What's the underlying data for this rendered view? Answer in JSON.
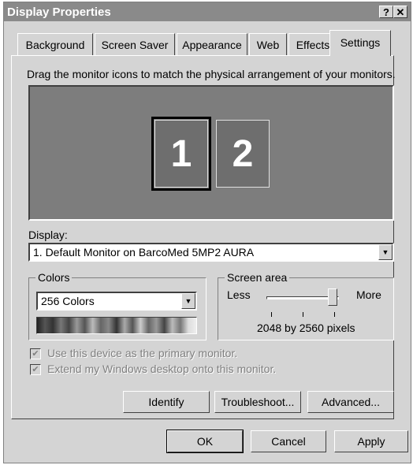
{
  "window": {
    "title": "Display Properties",
    "help_label": "?",
    "close_label": "✕"
  },
  "tabs": [
    {
      "label": "Background"
    },
    {
      "label": "Screen Saver"
    },
    {
      "label": "Appearance"
    },
    {
      "label": "Web"
    },
    {
      "label": "Effects"
    },
    {
      "label": "Settings",
      "active": true
    }
  ],
  "settings": {
    "instruction": "Drag the monitor icons to match the physical arrangement of your monitors.",
    "monitors": [
      {
        "label": "1",
        "selected": true
      },
      {
        "label": "2"
      }
    ],
    "display_label": "Display:",
    "display_value": "1. Default Monitor on BarcoMed 5MP2 AURA",
    "colors_group_title": "Colors",
    "colors_value": "256 Colors",
    "screen_area_title": "Screen area",
    "less_label": "Less",
    "more_label": "More",
    "resolution_text": "2048 by 2560 pixels",
    "slider_level": 1.0,
    "primary_checkbox_label": "Use this device as the primary monitor.",
    "extend_checkbox_label": "Extend my Windows desktop onto this monitor.",
    "identify_label": "Identify",
    "troubleshoot_label": "Troubleshoot...",
    "advanced_label": "Advanced..."
  },
  "footer": {
    "ok_label": "OK",
    "cancel_label": "Cancel",
    "apply_label": "Apply"
  }
}
